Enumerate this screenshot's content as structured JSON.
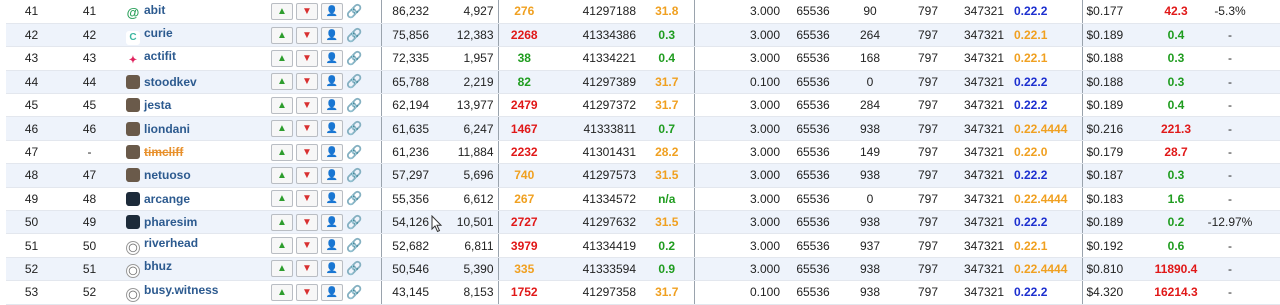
{
  "colors": {
    "green": "#1f9c1f",
    "red": "#e01818",
    "orange": "#f0a020",
    "blue": "#1c2fcf",
    "link": "#2c5a8f"
  },
  "rows": [
    {
      "rank": "41",
      "prev": "41",
      "name": "abit",
      "avatar": "at-sign",
      "votes": "86,232",
      "voters": "4,927",
      "missed": "276",
      "missed_color": "orange",
      "block": "41297188",
      "age": "31.8",
      "age_color": "orange",
      "fee": "3.000",
      "size": "65536",
      "rate": "90",
      "v1": "797",
      "v2": "347321",
      "ver": "0.22.2",
      "ver_color": "blue",
      "price": "$0.177",
      "change": "42.3",
      "change_color": "red",
      "pct": "-5.3%",
      "last": "-"
    },
    {
      "rank": "42",
      "prev": "42",
      "name": "curie",
      "avatar": "curie",
      "votes": "75,856",
      "voters": "12,383",
      "missed": "2268",
      "missed_color": "red",
      "block": "41334386",
      "age": "0.3",
      "age_color": "green",
      "fee": "3.000",
      "size": "65536",
      "rate": "264",
      "v1": "797",
      "v2": "347321",
      "ver": "0.22.1",
      "ver_color": "orange",
      "price": "$0.189",
      "change": "0.4",
      "change_color": "green",
      "pct": "-",
      "last": "-"
    },
    {
      "rank": "43",
      "prev": "43",
      "name": "actifit",
      "avatar": "actifit",
      "votes": "72,335",
      "voters": "1,957",
      "missed": "38",
      "missed_color": "green",
      "block": "41334221",
      "age": "0.4",
      "age_color": "green",
      "fee": "3.000",
      "size": "65536",
      "rate": "168",
      "v1": "797",
      "v2": "347321",
      "ver": "0.22.1",
      "ver_color": "orange",
      "price": "$0.188",
      "change": "0.3",
      "change_color": "green",
      "pct": "-",
      "last": "-"
    },
    {
      "rank": "44",
      "prev": "44",
      "name": "stoodkev",
      "avatar": "photo",
      "votes": "65,788",
      "voters": "2,219",
      "missed": "82",
      "missed_color": "green",
      "block": "41297389",
      "age": "31.7",
      "age_color": "orange",
      "fee": "0.100",
      "size": "65536",
      "rate": "0",
      "v1": "797",
      "v2": "347321",
      "ver": "0.22.2",
      "ver_color": "blue",
      "price": "$0.188",
      "change": "0.3",
      "change_color": "green",
      "pct": "-",
      "last": "-"
    },
    {
      "rank": "45",
      "prev": "45",
      "name": "jesta",
      "avatar": "photo",
      "votes": "62,194",
      "voters": "13,977",
      "missed": "2479",
      "missed_color": "red",
      "block": "41297372",
      "age": "31.7",
      "age_color": "orange",
      "fee": "3.000",
      "size": "65536",
      "rate": "284",
      "v1": "797",
      "v2": "347321",
      "ver": "0.22.2",
      "ver_color": "blue",
      "price": "$0.189",
      "change": "0.4",
      "change_color": "green",
      "pct": "-",
      "last": "-"
    },
    {
      "rank": "46",
      "prev": "46",
      "name": "liondani",
      "avatar": "photo",
      "votes": "61,635",
      "voters": "6,247",
      "missed": "1467",
      "missed_color": "red",
      "block": "41333811",
      "age": "0.7",
      "age_color": "green",
      "fee": "3.000",
      "size": "65536",
      "rate": "938",
      "v1": "797",
      "v2": "347321",
      "ver": "0.22.4444",
      "ver_color": "orange",
      "price": "$0.216",
      "change": "221.3",
      "change_color": "red",
      "pct": "-",
      "last": "-"
    },
    {
      "rank": "47",
      "prev": "-",
      "name": "timcliff",
      "avatar": "photo",
      "strike": true,
      "votes": "61,236",
      "voters": "11,884",
      "missed": "2232",
      "missed_color": "red",
      "block": "41301431",
      "age": "28.2",
      "age_color": "orange",
      "fee": "3.000",
      "size": "65536",
      "rate": "149",
      "v1": "797",
      "v2": "347321",
      "ver": "0.22.0",
      "ver_color": "orange",
      "price": "$0.179",
      "change": "28.7",
      "change_color": "red",
      "pct": "-",
      "last": "-"
    },
    {
      "rank": "48",
      "prev": "47",
      "name": "netuoso",
      "avatar": "photo",
      "votes": "57,297",
      "voters": "5,696",
      "missed": "740",
      "missed_color": "orange",
      "block": "41297573",
      "age": "31.5",
      "age_color": "orange",
      "fee": "3.000",
      "size": "65536",
      "rate": "938",
      "v1": "797",
      "v2": "347321",
      "ver": "0.22.2",
      "ver_color": "blue",
      "price": "$0.187",
      "change": "0.3",
      "change_color": "green",
      "pct": "-",
      "last": "-"
    },
    {
      "rank": "49",
      "prev": "48",
      "name": "arcange",
      "avatar": "dark",
      "votes": "55,356",
      "voters": "6,612",
      "missed": "267",
      "missed_color": "orange",
      "block": "41334572",
      "age": "n/a",
      "age_color": "green",
      "fee": "3.000",
      "size": "65536",
      "rate": "0",
      "v1": "797",
      "v2": "347321",
      "ver": "0.22.4444",
      "ver_color": "orange",
      "price": "$0.183",
      "change": "1.6",
      "change_color": "green",
      "pct": "-",
      "last": "-"
    },
    {
      "rank": "50",
      "prev": "49",
      "name": "pharesim",
      "avatar": "dark",
      "votes": "54,126",
      "voters": "10,501",
      "missed": "2727",
      "missed_color": "red",
      "block": "41297632",
      "age": "31.5",
      "age_color": "orange",
      "fee": "3.000",
      "size": "65536",
      "rate": "938",
      "v1": "797",
      "v2": "347321",
      "ver": "0.22.2",
      "ver_color": "blue",
      "price": "$0.189",
      "change": "0.2",
      "change_color": "green",
      "pct": "-12.97%",
      "last": "-"
    },
    {
      "rank": "51",
      "prev": "50",
      "name": "riverhead",
      "avatar": "user",
      "votes": "52,682",
      "voters": "6,811",
      "missed": "3979",
      "missed_color": "red",
      "block": "41334419",
      "age": "0.2",
      "age_color": "green",
      "fee": "3.000",
      "size": "65536",
      "rate": "937",
      "v1": "797",
      "v2": "347321",
      "ver": "0.22.1",
      "ver_color": "orange",
      "price": "$0.192",
      "change": "0.6",
      "change_color": "green",
      "pct": "-",
      "last": "-"
    },
    {
      "rank": "52",
      "prev": "51",
      "name": "bhuz",
      "avatar": "user",
      "votes": "50,546",
      "voters": "5,390",
      "missed": "335",
      "missed_color": "orange",
      "block": "41333594",
      "age": "0.9",
      "age_color": "green",
      "fee": "3.000",
      "size": "65536",
      "rate": "938",
      "v1": "797",
      "v2": "347321",
      "ver": "0.22.4444",
      "ver_color": "orange",
      "price": "$0.810",
      "change": "11890.4",
      "change_color": "red",
      "pct": "-",
      "last": "-"
    },
    {
      "rank": "53",
      "prev": "52",
      "name": "busy.witness",
      "avatar": "user",
      "votes": "43,145",
      "voters": "8,153",
      "missed": "1752",
      "missed_color": "red",
      "block": "41297358",
      "age": "31.7",
      "age_color": "orange",
      "fee": "0.100",
      "size": "65536",
      "rate": "938",
      "v1": "797",
      "v2": "347321",
      "ver": "0.22.2",
      "ver_color": "blue",
      "price": "$4.320",
      "change": "16214.3",
      "change_color": "red",
      "pct": "-",
      "last": "-"
    }
  ]
}
